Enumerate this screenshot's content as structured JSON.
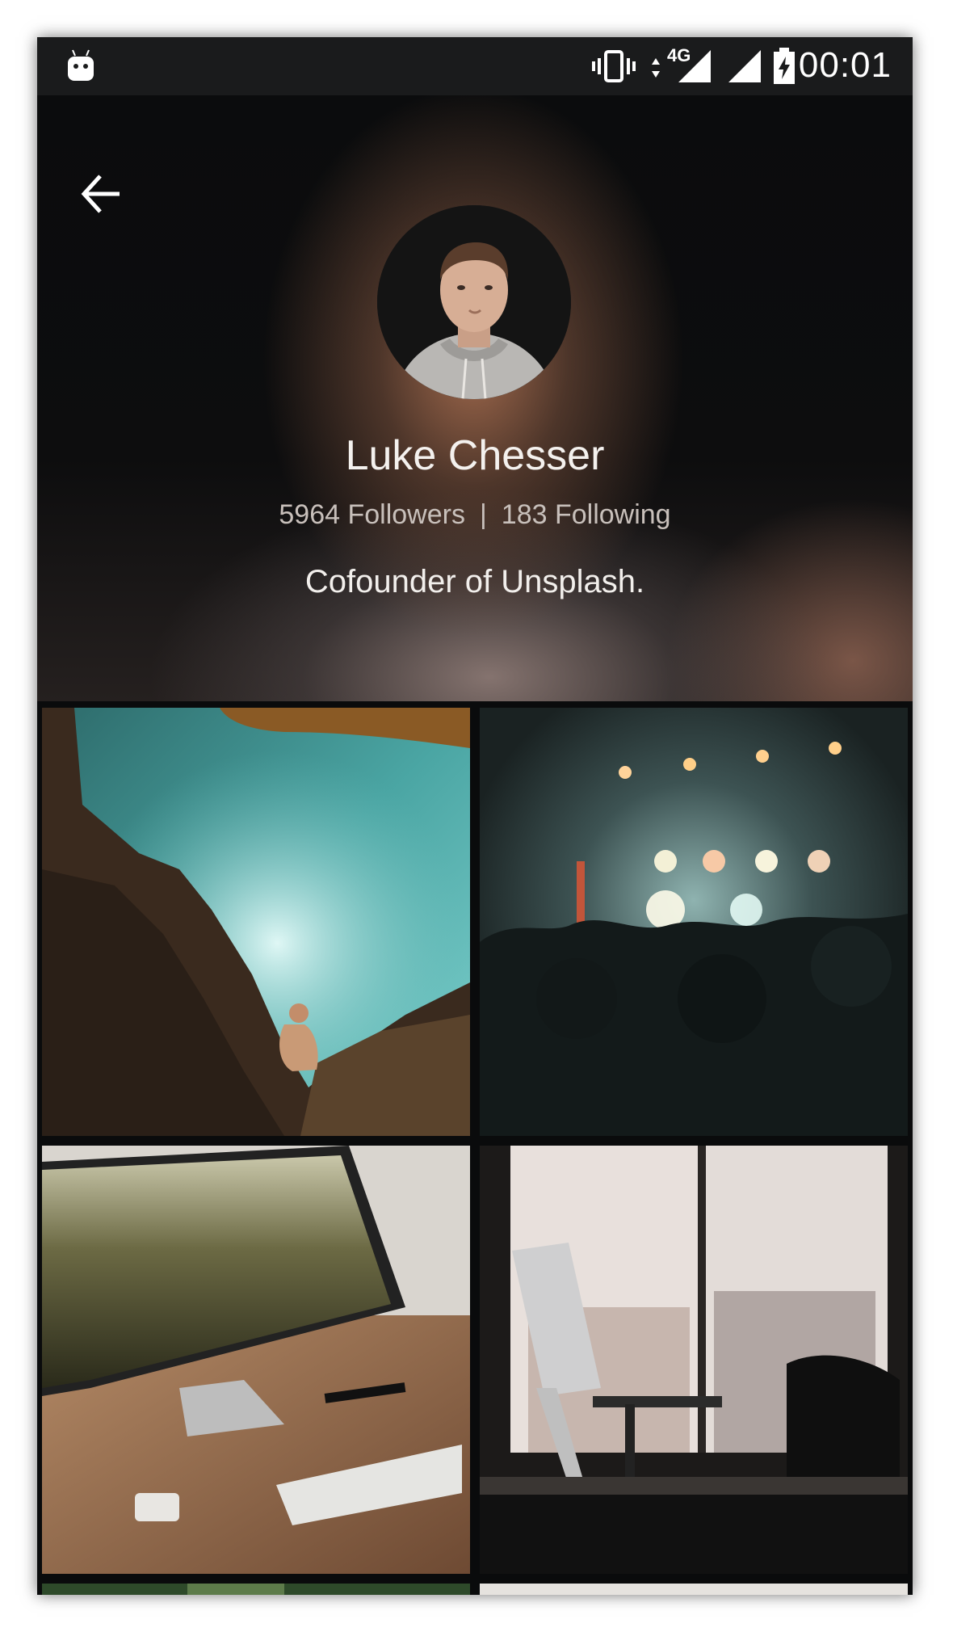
{
  "status_bar": {
    "time": "00:01",
    "network": "4G",
    "icons": [
      "android-icon",
      "vibrate-icon",
      "data-arrows-icon",
      "signal-icon",
      "signal-icon",
      "battery-charging-icon"
    ]
  },
  "header": {
    "back_icon": "arrow-left-icon",
    "name": "Luke Chesser",
    "followers": "5964 Followers",
    "separator": "|",
    "following": "183 Following",
    "bio": "Cofounder of Unsplash."
  },
  "photos": [
    {
      "subject": "ocean-cliff-photo"
    },
    {
      "subject": "concert-crowd-photo"
    },
    {
      "subject": "desk-monitor-photo"
    },
    {
      "subject": "window-desk-photo"
    },
    {
      "subject": "forest-photo"
    },
    {
      "subject": "light-photo"
    }
  ],
  "colors": {
    "status_bar": "#1a1b1c",
    "background": "#0a0b0c",
    "text_primary": "#f4f1ee",
    "text_secondary": "#c8c0bb"
  }
}
